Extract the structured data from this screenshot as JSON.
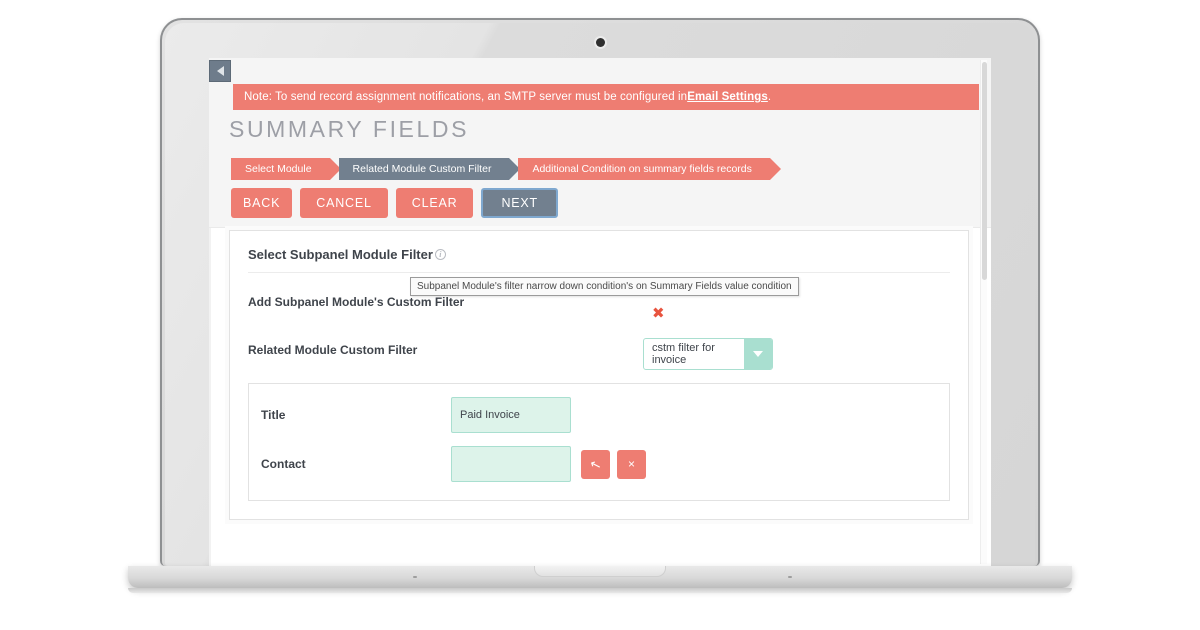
{
  "app": {
    "collapse_icon": "collapse-left-icon",
    "notice": {
      "text_before": "Note: To send record assignment notifications, an SMTP server must be configured in ",
      "link_label": "Email Settings",
      "text_after": "."
    },
    "page_title": "SUMMARY FIELDS",
    "breadcrumbs": [
      {
        "label": "Select Module",
        "active": false
      },
      {
        "label": "Related Module Custom Filter",
        "active": true
      },
      {
        "label": "Additional Condition on summary fields records",
        "active": false
      }
    ],
    "buttons": [
      {
        "label": "BACK",
        "style": "coral"
      },
      {
        "label": "CANCEL",
        "style": "coral"
      },
      {
        "label": "CLEAR",
        "style": "coral"
      },
      {
        "label": "NEXT",
        "style": "slate-focused"
      }
    ],
    "panel": {
      "heading": "Select Subpanel Module Filter",
      "info_icon": "info-icon",
      "rows": [
        {
          "label": "Add Subpanel Module's Custom Filter",
          "tooltip": "Subpanel Module's filter narrow down condition's on Summary Fields value condition",
          "remove_icon": "x-remove-icon"
        },
        {
          "label": "Related Module Custom Filter",
          "select_value": "cstm filter for invoice",
          "select_icon": "chevron-down-icon"
        }
      ],
      "fields": [
        {
          "label": "Title",
          "value": "Paid Invoice",
          "placeholder": ""
        },
        {
          "label": "Contact",
          "value": "",
          "placeholder": "",
          "actions": [
            {
              "icon": "select-cursor-icon",
              "glyph": "↖"
            },
            {
              "icon": "clear-x-icon",
              "glyph": "×"
            }
          ]
        }
      ]
    }
  },
  "colors": {
    "coral": "#ee7d72",
    "slate": "#72808f",
    "mint_border": "#a9dfd0",
    "mint_fill": "#ddf3ea",
    "focus_blue": "#7fa8cf",
    "title_gray": "#9d9fa6"
  }
}
